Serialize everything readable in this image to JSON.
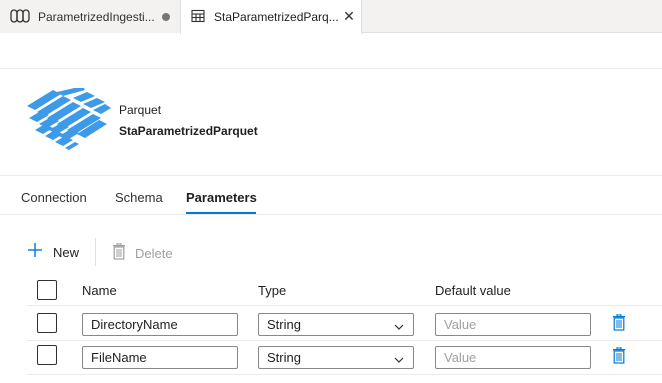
{
  "tabs": [
    {
      "label": "ParametrizedIngesti...",
      "icon": "pipeline-icon",
      "state": "unsaved"
    },
    {
      "label": "StaParametrizedParq...",
      "icon": "table-icon",
      "state": "active"
    }
  ],
  "dataset": {
    "type": "Parquet",
    "name": "StaParametrizedParquet",
    "icon": "parquet-icon",
    "icon_color": "#3c9ae8"
  },
  "section_tabs": [
    {
      "label": "Connection"
    },
    {
      "label": "Schema"
    },
    {
      "label": "Parameters",
      "active": true
    }
  ],
  "toolbar": {
    "new_label": "New",
    "delete_label": "Delete"
  },
  "table": {
    "headers": {
      "name": "Name",
      "type": "Type",
      "default": "Default value"
    },
    "rows": [
      {
        "name": "DirectoryName",
        "type": "String",
        "default_placeholder": "Value"
      },
      {
        "name": "FileName",
        "type": "String",
        "default_placeholder": "Value"
      }
    ]
  },
  "colors": {
    "accent": "#0078d4",
    "trash": "#0078d4"
  }
}
